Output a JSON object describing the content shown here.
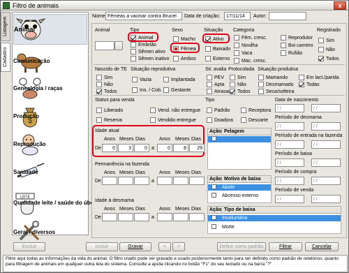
{
  "window": {
    "title": "Filtro de animais",
    "close_label": "x"
  },
  "side_tabs": {
    "listagem": "Listagem",
    "cadastro": "Cadastro"
  },
  "categories": [
    {
      "label": "Animal",
      "icon": "cow-icon"
    },
    {
      "label": "Comunicação",
      "icon": "calf-icon"
    },
    {
      "label": "Genealogia / raças",
      "icon": "family-tree-icon"
    },
    {
      "label": "Produção",
      "icon": "money-bag-icon"
    },
    {
      "label": "Reprodução",
      "icon": "baby-icon"
    },
    {
      "label": "Sanidade",
      "icon": "syringe-icon"
    },
    {
      "label": "Qualidade leite / saúde do úbere",
      "icon": "milk-quality-icon"
    },
    {
      "label": "Geral / diversos",
      "icon": "tools-icon"
    }
  ],
  "header": {
    "name_label": "Nome:",
    "name_value": "Fêmeas a vacinar contra Brucel",
    "date_label": "Data de criação:",
    "date_value": "17/11/14",
    "author_label": "Autor:",
    "author_value": ""
  },
  "animal": {
    "label": "Animal",
    "value": ""
  },
  "tipo": {
    "title": "Tipo",
    "options": [
      {
        "label": "Animal",
        "checked": true
      },
      {
        "label": "Embrião",
        "checked": false
      },
      {
        "label": "Sêmen ativo",
        "checked": false
      },
      {
        "label": "Sêmen inativo",
        "checked": false
      }
    ]
  },
  "sexo": {
    "title": "Sexo",
    "options": [
      {
        "label": "Macho",
        "checked": false
      },
      {
        "label": "Fêmea",
        "checked": true
      },
      {
        "label": "Ambos",
        "checked": false
      }
    ]
  },
  "situacao": {
    "title": "Situação",
    "options": [
      {
        "label": "Ativo",
        "checked": true
      },
      {
        "label": "Baixado",
        "checked": false
      },
      {
        "label": "Externo",
        "checked": false
      }
    ]
  },
  "categoria": {
    "title": "Categoria",
    "col1": [
      "Fêm. cresc.",
      "Novilha",
      "Vaca",
      "Mac. cresc."
    ],
    "col2": [
      "Reprodutor",
      "Boi carreiro",
      "Rufião"
    ]
  },
  "registrado": {
    "title": "Registrado",
    "options": [
      "Sim",
      "Não",
      "Todos"
    ]
  },
  "nascido_te": {
    "title": "Nascido de TE",
    "options": [
      "Sim",
      "Não",
      "Todos"
    ]
  },
  "sit_reprodutiva": {
    "title": "Situação reprodutiva",
    "col1": [
      "Vazia",
      "Ins. / Cob."
    ],
    "col2": [
      "Implantada",
      "Gestante"
    ]
  },
  "sit_avaliacao": {
    "title": "Sit. avalia",
    "options": [
      "PEV",
      "Apta",
      "Atrasada"
    ]
  },
  "protocolada": {
    "title": "Protocolada",
    "options": [
      "Sim",
      "Não",
      "Todos"
    ]
  },
  "sit_produtiva": {
    "title": "Situação produtiva",
    "col1": [
      "Mamando",
      "Desmamado",
      "Seca/solteira"
    ],
    "col2": [
      "Em lact./parida",
      "Todas"
    ]
  },
  "status_venda": {
    "title": "Status para venda",
    "col1": [
      "Liberado",
      "Reserva"
    ],
    "col2": [
      "Vend. não entregue",
      "Vendido entregue"
    ]
  },
  "tipo2": {
    "title": "Tipo",
    "col1": [
      "Padrão",
      "Doadora"
    ],
    "col2": [
      "Receptora",
      "Descarte"
    ]
  },
  "idade_atual": {
    "title": "Idade atual",
    "de_label": "De",
    "a_label": "a",
    "headers": [
      "Anos",
      "Meses",
      "Dias",
      "Anos",
      "Meses",
      "Dias"
    ],
    "from": [
      "0",
      "3",
      "0"
    ],
    "to": [
      "0",
      "8",
      "29"
    ]
  },
  "permanencia": {
    "title": "Permanência na fazenda",
    "de_label": "De",
    "a_label": "a",
    "headers": [
      "Anos",
      "Meses",
      "Dias",
      "Anos",
      "Meses",
      "Dias"
    ]
  },
  "idade_desmama": {
    "title": "Idade à desmama",
    "de_label": "De",
    "a_label": "a",
    "headers": [
      "Anos",
      "Meses",
      "Dias",
      "Anos",
      "Meses",
      "Dias"
    ]
  },
  "pelagem": {
    "acao": "Ação",
    "title": "Pelagem"
  },
  "motivo_baixa": {
    "acao": "Ação",
    "title": "Motivo de baixa",
    "rows": [
      "Abate",
      "Abcesso externo"
    ]
  },
  "tipo_baixa": {
    "acao": "Ação",
    "title": "Tipo de baixa",
    "rows": [
      "Involuntária",
      "Morte"
    ]
  },
  "periods": [
    {
      "label": "Data de nascimento"
    },
    {
      "label": "Período de desmama"
    },
    {
      "label": "Período de entrada na fazenda"
    },
    {
      "label": "Período de baixa"
    },
    {
      "label": "Período de compra"
    },
    {
      "label": "Período de venda"
    }
  ],
  "date_placeholder": "/ /",
  "buttons": {
    "excluir": "Excluir",
    "incluir": "Incluir",
    "gravar": "Gravar",
    "prev": "<",
    "next": ">",
    "definir": "Definir como padrão",
    "filtrar": "Filtrar",
    "cancelar": "Cancelar"
  },
  "status_text": "Filtre aqui todas as informações da vida do animal. O filtro criado pode ser gravado e usado posteriormente tanto para ser definido como padrão de relatórios, quanto para filtragem de animais em qualquer outra tela do sistema. Consulte a ajuda clicando no botão \"F1\" do seu teclado ou na barra \"?\""
}
